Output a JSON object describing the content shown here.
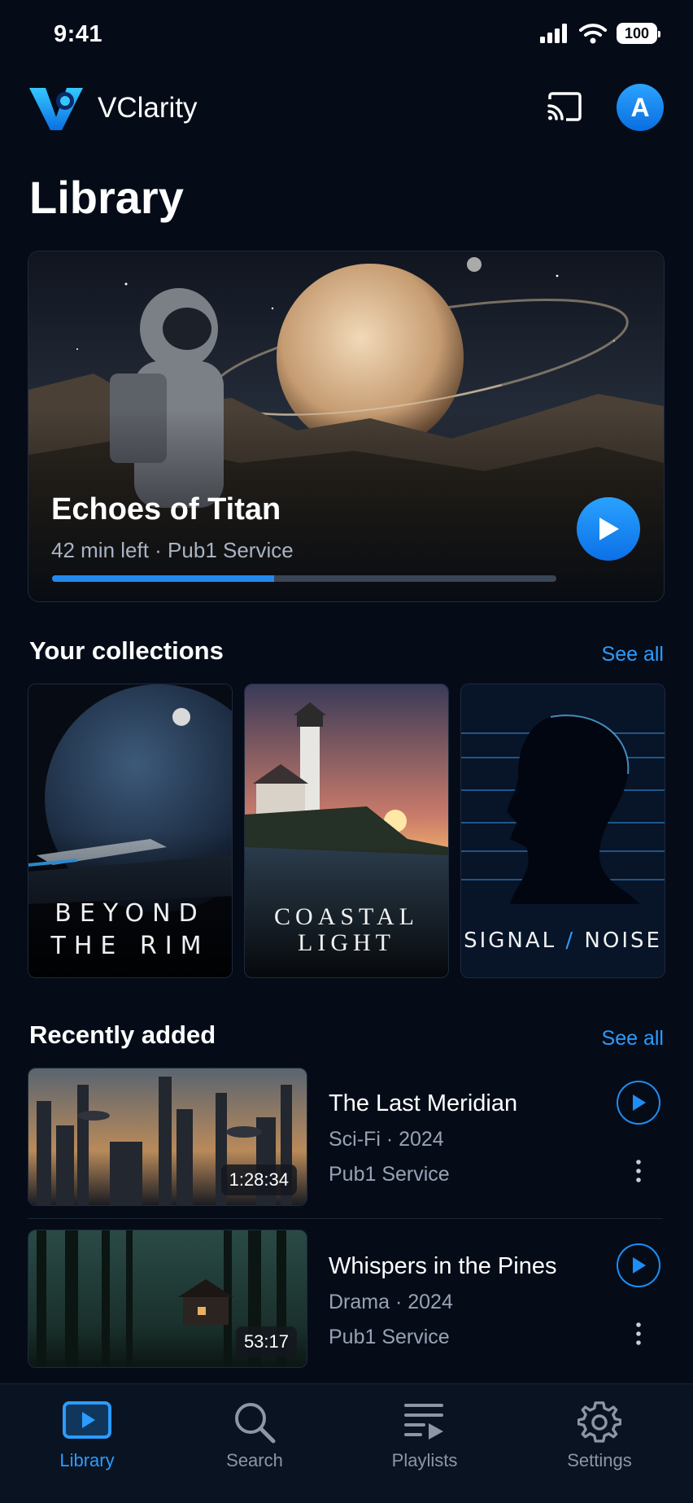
{
  "status_bar": {
    "time": "9:41",
    "battery": "100"
  },
  "app": {
    "name": "VClarity",
    "avatar_initial": "A"
  },
  "page": {
    "title": "Library"
  },
  "continue_watching": {
    "title": "Echoes of Titan",
    "meta": "42 min left · Pub1 Service",
    "progress": 0.44
  },
  "collections": {
    "title": "Your collections",
    "see_all": "See all",
    "items": [
      {
        "line1": "BEYOND",
        "line2": "THE RIM"
      },
      {
        "line1": "COASTAL",
        "line2": "LIGHT"
      },
      {
        "part1": "SIGNAL",
        "sep": "/",
        "part2": "NOISE"
      }
    ]
  },
  "recently_added": {
    "title": "Recently added",
    "see_all": "See all",
    "items": [
      {
        "title": "The Last Meridian",
        "meta": "Sci-Fi · 2024",
        "service": "Pub1 Service",
        "duration": "1:28:34"
      },
      {
        "title": "Whispers in the Pines",
        "meta": "Drama · 2024",
        "service": "Pub1 Service",
        "duration": "53:17"
      }
    ]
  },
  "nav": [
    {
      "label": "Library",
      "icon": "play-rectangle-icon",
      "active": true
    },
    {
      "label": "Search",
      "icon": "search-icon",
      "active": false
    },
    {
      "label": "Playlists",
      "icon": "playlist-icon",
      "active": false
    },
    {
      "label": "Settings",
      "icon": "gear-icon",
      "active": false
    }
  ],
  "colors": {
    "accent": "#2b9cff",
    "background": "#050c18"
  }
}
